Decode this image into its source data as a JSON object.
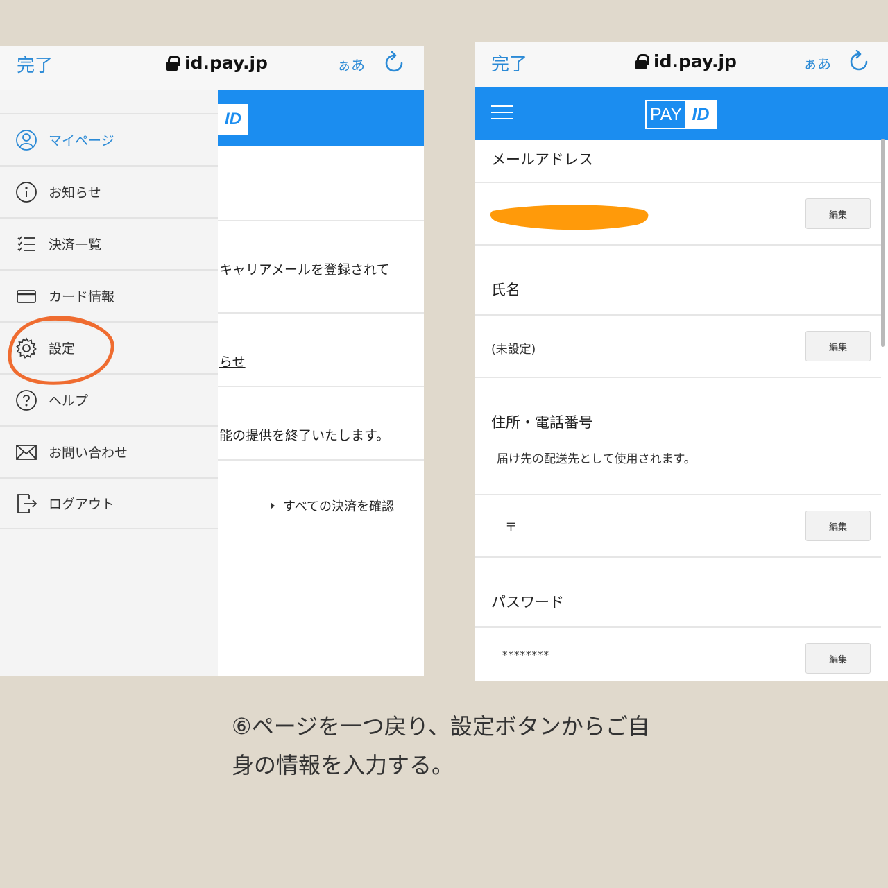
{
  "browser": {
    "done_label": "完了",
    "url": "id.pay.jp",
    "text_size_label": "ぁあ"
  },
  "left": {
    "logo_text": "ID",
    "page_links": [
      "キャリアメールを登録されて",
      "らせ",
      "能の提供を終了いたします。"
    ],
    "see_all_label": "すべての決済を確認",
    "menu": [
      {
        "label": "マイページ",
        "icon": "user-icon"
      },
      {
        "label": "お知らせ",
        "icon": "info-icon"
      },
      {
        "label": "決済一覧",
        "icon": "list-icon"
      },
      {
        "label": "カード情報",
        "icon": "card-icon"
      },
      {
        "label": "設定",
        "icon": "gear-icon"
      },
      {
        "label": "ヘルプ",
        "icon": "help-icon"
      },
      {
        "label": "お問い合わせ",
        "icon": "mail-icon"
      },
      {
        "label": "ログアウト",
        "icon": "logout-icon"
      }
    ]
  },
  "right": {
    "logo_pay": "PAY",
    "logo_id": "ID",
    "email_label": "メールアドレス",
    "name_label": "氏名",
    "name_value": "(未設定)",
    "address_label": "住所・電話番号",
    "address_note": "届け先の配送先として使用されます。",
    "postal_prefix": "〒",
    "password_label": "パスワード",
    "password_value": "********",
    "edit_label": "編集"
  },
  "caption": {
    "line1": "⑥ページを一つ戻り、設定ボタンからご自",
    "line2": "身の情報を入力する。"
  },
  "colors": {
    "brand_blue": "#1b8df0",
    "link_blue": "#2b8ad6",
    "annotation_orange": "#ef6c30",
    "redaction_orange": "#ff9a0a"
  }
}
